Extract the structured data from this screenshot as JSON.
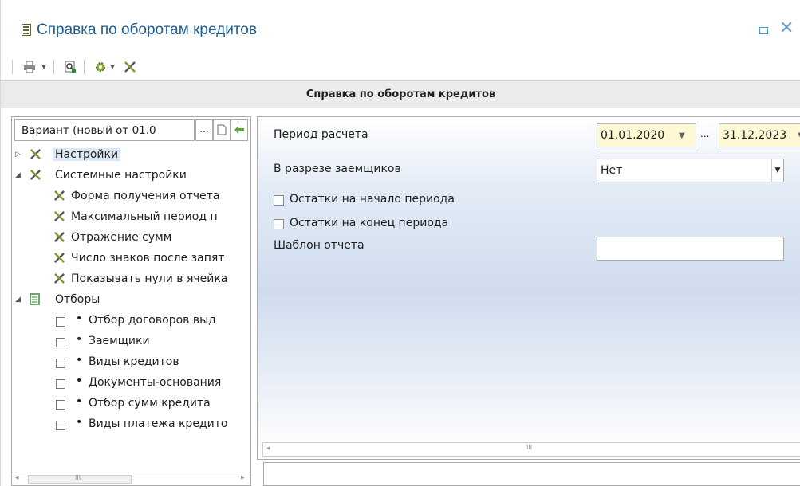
{
  "window": {
    "title": "Справка по оборотам кредитов",
    "restore_icon": "restore-icon",
    "close_icon": "close-icon",
    "close_glyph": "✕"
  },
  "toolbar": {
    "print_icon": "printer-icon",
    "dropdown_glyph": "▾",
    "preview_icon": "print-preview-icon",
    "settings_icon": "gear-icon",
    "tools_icon": "tools-icon"
  },
  "banner": {
    "text": "Справка по оборотам кредитов"
  },
  "left_panel": {
    "variant_value": "Вариант (новый от 01.0",
    "ellipsis_label": "...",
    "tree": [
      {
        "label": "Настройки",
        "level": 0,
        "expander": "▷",
        "icon": "tools-icon",
        "selected": true
      },
      {
        "label": "Системные настройки",
        "level": 0,
        "expander": "◢",
        "icon": "tools-icon"
      },
      {
        "label": "Форма получения отчета",
        "level": 1,
        "icon": "tools-icon"
      },
      {
        "label": "Максимальный период п",
        "level": 1,
        "icon": "tools-icon"
      },
      {
        "label": "Отражение сумм",
        "level": 1,
        "icon": "tools-icon"
      },
      {
        "label": "Число знаков после запят",
        "level": 1,
        "icon": "tools-icon"
      },
      {
        "label": "Показывать нули в ячейка",
        "level": 1,
        "icon": "tools-icon"
      },
      {
        "label": "Отборы",
        "level": 0,
        "expander": "◢",
        "icon": "filter-icon"
      },
      {
        "label": "Отбор договоров выд",
        "level": 1,
        "checkbox": true
      },
      {
        "label": "Заемщики",
        "level": 1,
        "checkbox": true
      },
      {
        "label": "Виды кредитов",
        "level": 1,
        "checkbox": true
      },
      {
        "label": "Документы-основания",
        "level": 1,
        "checkbox": true
      },
      {
        "label": "Отбор сумм кредита",
        "level": 1,
        "checkbox": true
      },
      {
        "label": "Виды платежа кредито",
        "level": 1,
        "checkbox": true
      }
    ],
    "scroll_grip": "III"
  },
  "form": {
    "period_label": "Период расчета",
    "date_from": "01.01.2020",
    "date_sep": "...",
    "date_to": "31.12.2023",
    "borrowers_label": "В разрезе заемщиков",
    "borrowers_value": "Нет",
    "opening_balance_label": "Остатки на начало периода",
    "closing_balance_label": "Остатки на конец периода",
    "template_label": "Шаблон отчета",
    "template_value": "",
    "scroll_grip": "III"
  }
}
